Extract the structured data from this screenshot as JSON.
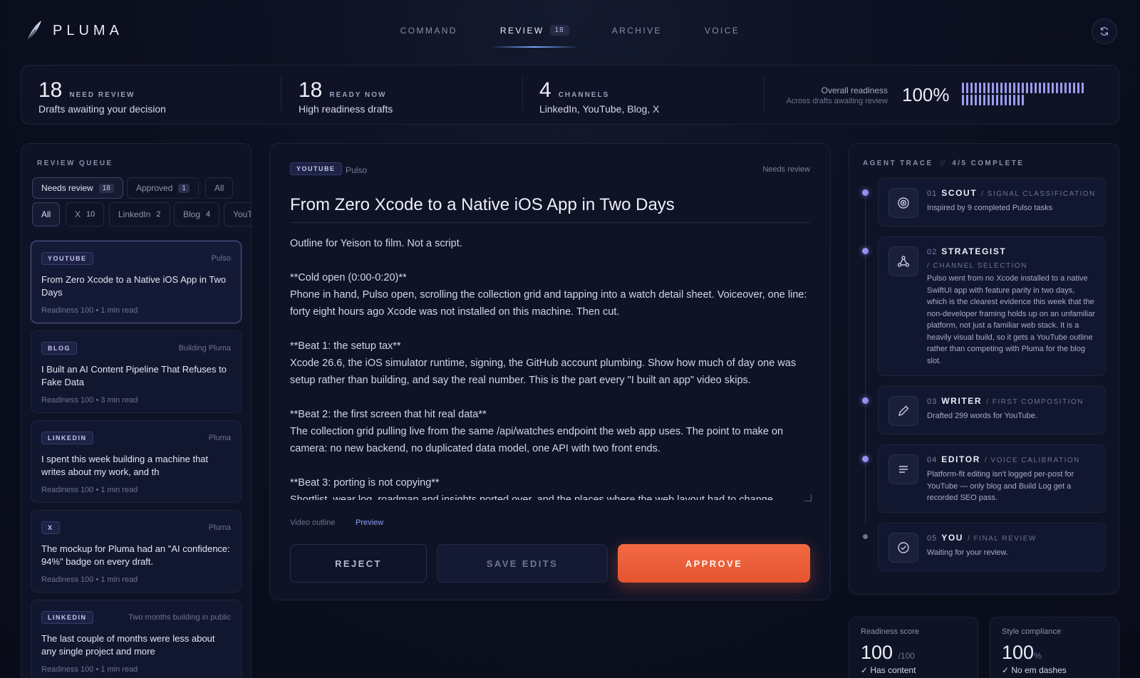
{
  "app": {
    "name": "PLUMA"
  },
  "nav": {
    "items": [
      {
        "label": "COMMAND"
      },
      {
        "label": "REVIEW",
        "badge": "18"
      },
      {
        "label": "ARCHIVE"
      },
      {
        "label": "VOICE"
      }
    ],
    "active": "REVIEW"
  },
  "stats": {
    "need_review": {
      "value": "18",
      "label": "NEED REVIEW",
      "sub": "Drafts awaiting your decision"
    },
    "ready_now": {
      "value": "18",
      "label": "READY NOW",
      "sub": "High readiness drafts"
    },
    "channels": {
      "value": "4",
      "label": "CHANNELS",
      "sub": "LinkedIn, YouTube, Blog, X"
    },
    "readiness": {
      "title": "Overall readiness",
      "sub": "Across drafts awaiting review",
      "value": "100%",
      "fraction": 1.0
    }
  },
  "queue": {
    "label": "REVIEW QUEUE",
    "status_filters": [
      {
        "label": "Needs review",
        "count": "18",
        "active": true
      },
      {
        "label": "Approved",
        "count": "1",
        "active": false
      },
      {
        "label": "All",
        "count": "",
        "active": false
      }
    ],
    "channel_filters": [
      {
        "label": "All",
        "count": "",
        "active": true
      },
      {
        "label": "X",
        "count": "10",
        "active": false
      },
      {
        "label": "LinkedIn",
        "count": "2",
        "active": false
      },
      {
        "label": "Blog",
        "count": "4",
        "active": false
      },
      {
        "label": "YouTube",
        "count": "",
        "active": false
      }
    ],
    "items": [
      {
        "tag": "YOUTUBE",
        "source": "Pulso",
        "title": "From Zero Xcode to a Native iOS App in Two Days",
        "meta": "Readiness 100 • 1 min read",
        "active": true
      },
      {
        "tag": "BLOG",
        "source": "Building Pluma",
        "title": "I Built an AI Content Pipeline That Refuses to Fake Data",
        "meta": "Readiness 100 • 3 min read",
        "active": false
      },
      {
        "tag": "LINKEDIN",
        "source": "Pluma",
        "title": "I spent this week building a machine that writes about my work, and th",
        "meta": "Readiness 100 • 1 min read",
        "active": false
      },
      {
        "tag": "X",
        "source": "Pluma",
        "title": "The mockup for Pluma had an \"AI confidence: 94%\" badge on every draft.",
        "meta": "Readiness 100 • 1 min read",
        "active": false
      },
      {
        "tag": "LINKEDIN",
        "source": "Two months building in public",
        "title": "The last couple of months were less about any single project and more",
        "meta": "Readiness 100 • 1 min read",
        "active": false
      }
    ]
  },
  "draft": {
    "tag": "YOUTUBE",
    "source": "Pulso",
    "status": "Needs review",
    "title": "From Zero Xcode to a Native iOS App in Two Days",
    "body": "Outline for Yeison to film. Not a script.\n\n**Cold open (0:00-0:20)**\nPhone in hand, Pulso open, scrolling the collection grid and tapping into a watch detail sheet. Voiceover, one line: forty eight hours ago Xcode was not installed on this machine. Then cut.\n\n**Beat 1: the setup tax**\nXcode 26.6, the iOS simulator runtime, signing, the GitHub account plumbing. Show how much of day one was setup rather than building, and say the real number. This is the part every \"I built an app\" video skips.\n\n**Beat 2: the first screen that hit real data**\nThe collection grid pulling live from the same /api/watches endpoint the web app uses. The point to make on camera: no new backend, no duplicated data model, one API with two front ends.\n\n**Beat 3: porting is not copying**\nShortlist, wear log, roadmap and insights ported over, and the places where the web layout had to change",
    "format": "Video outline",
    "preview_label": "Preview",
    "actions": {
      "reject": "REJECT",
      "save": "SAVE EDITS",
      "approve": "APPROVE"
    }
  },
  "trace": {
    "label": "AGENT TRACE",
    "progress": "4/5 COMPLETE",
    "steps": [
      {
        "num": "01",
        "name": "SCOUT",
        "role": "/ SIGNAL CLASSIFICATION",
        "desc": "Inspired by 9 completed Pulso tasks",
        "icon": "target-icon",
        "done": true
      },
      {
        "num": "02",
        "name": "STRATEGIST",
        "role": "/ CHANNEL SELECTION",
        "desc": "Pulso went from no Xcode installed to a native SwiftUI app with feature parity in two days, which is the clearest evidence this week that the non-developer framing holds up on an unfamiliar platform, not just a familiar web stack. It is a heavily visual build, so it gets a YouTube outline rather than competing with Pluma for the blog slot.",
        "icon": "network-icon",
        "done": true
      },
      {
        "num": "03",
        "name": "WRITER",
        "role": "/ FIRST COMPOSITION",
        "desc": "Drafted 299 words for YouTube.",
        "icon": "pen-icon",
        "done": true
      },
      {
        "num": "04",
        "name": "EDITOR",
        "role": "/ VOICE CALIBRATION",
        "desc": "Platform-fit editing isn't logged per-post for YouTube — only blog and Build Log get a recorded SEO pass.",
        "icon": "lines-icon",
        "done": true
      },
      {
        "num": "05",
        "name": "YOU",
        "role": "/ FINAL REVIEW",
        "desc": "Waiting for your review.",
        "icon": "check-circle-icon",
        "done": false
      }
    ]
  },
  "scores": {
    "readiness": {
      "label": "Readiness score",
      "value": "100",
      "unit": "/100",
      "check": "✓ Has content"
    },
    "style": {
      "label": "Style compliance",
      "value": "100",
      "unit": "%",
      "check": "✓ No em dashes"
    }
  }
}
